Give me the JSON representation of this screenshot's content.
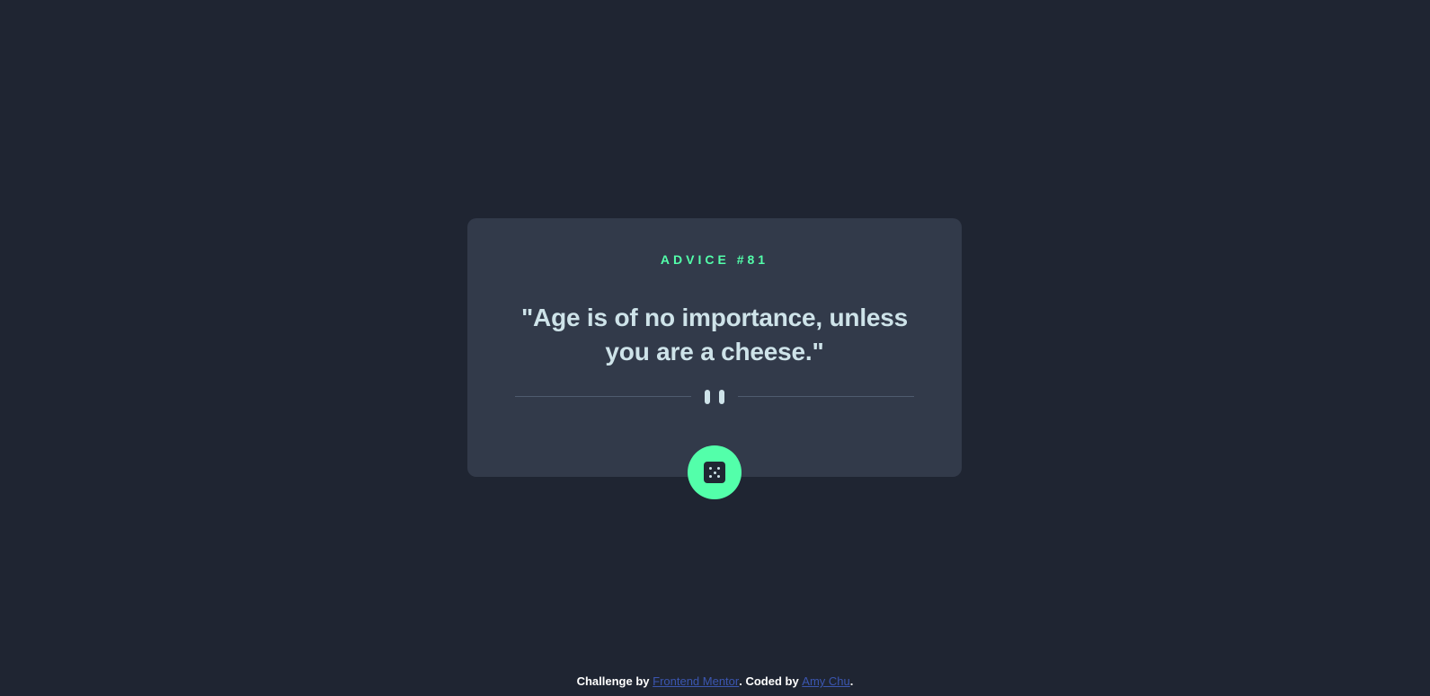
{
  "card": {
    "advice_label": "ADVICE #81",
    "quote": "\"Age is of no importance, unless you are a cheese.\""
  },
  "divider": {
    "icon": "pause-icon"
  },
  "dice_button": {
    "icon": "dice-icon"
  },
  "footer": {
    "prefix": "Challenge by ",
    "challenge_link": "Frontend Mentor",
    "middle": ". Coded by ",
    "author_link": "Amy Chu",
    "suffix": "."
  },
  "colors": {
    "background": "#1f2532",
    "card": "#323a4a",
    "accent": "#53ffaa",
    "text": "#cee3e9",
    "link": "#3b56b0"
  }
}
